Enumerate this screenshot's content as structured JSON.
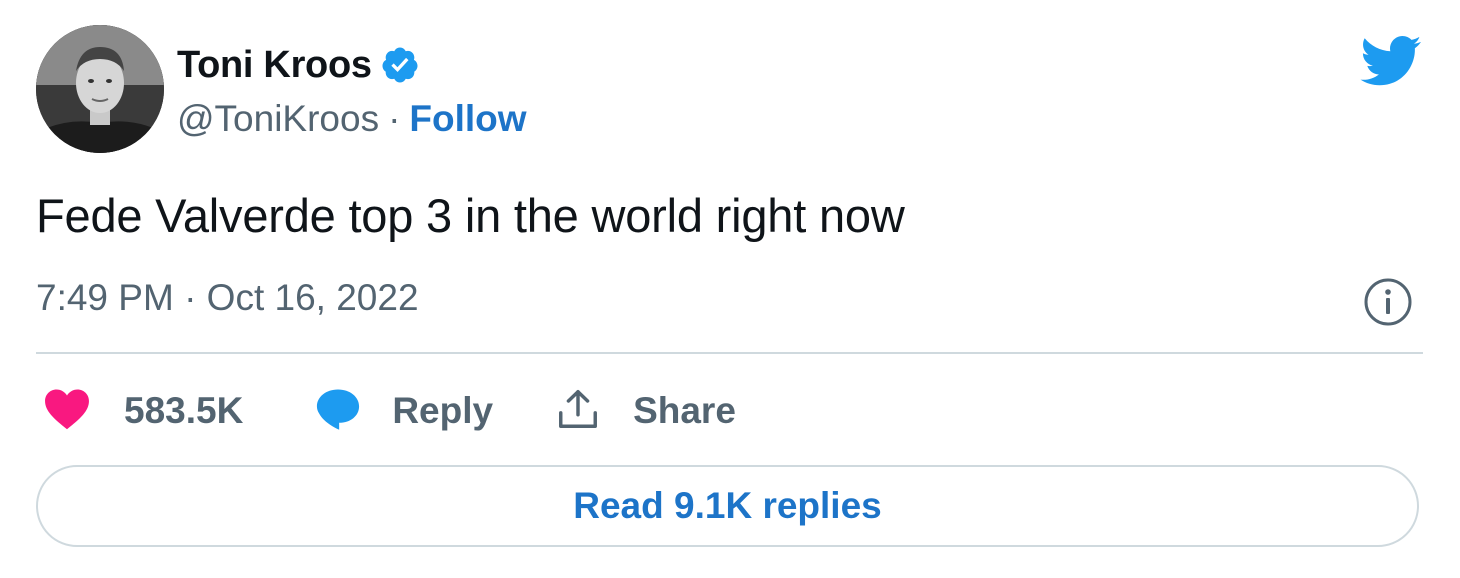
{
  "author": {
    "name": "Toni Kroos",
    "handle": "@ToniKroos",
    "separator": "·",
    "follow_label": "Follow",
    "verified": true
  },
  "tweet": {
    "text": "Fede Valverde top 3 in the world right now",
    "timestamp": "7:49 PM · Oct 16, 2022"
  },
  "actions": {
    "like_count": "583.5K",
    "reply_label": "Reply",
    "share_label": "Share"
  },
  "read_replies_label": "Read 9.1K replies",
  "icons": {
    "brand": "twitter-bird-icon",
    "verified": "verified-badge-icon",
    "info": "info-icon",
    "like": "heart-icon",
    "reply": "speech-bubble-icon",
    "share": "share-upload-icon"
  },
  "colors": {
    "twitter_blue": "#1d9bf0",
    "link_blue": "#1d74c8",
    "like_pink": "#f91880",
    "muted_text": "#536471",
    "divider": "#cfd9de"
  }
}
